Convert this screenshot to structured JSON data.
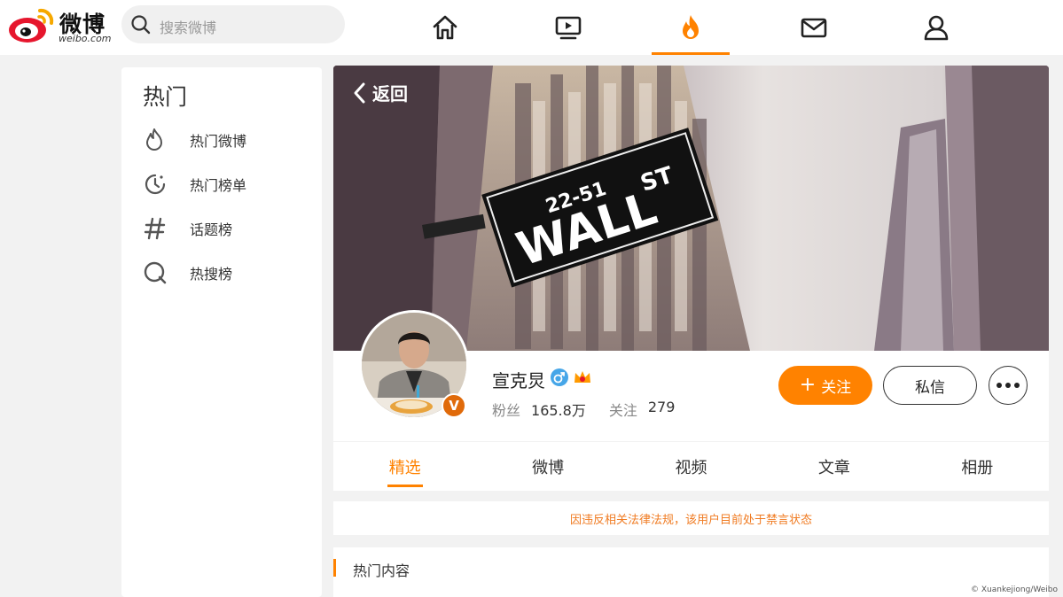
{
  "header": {
    "logo_text": "微博",
    "logo_sub": "weibo.com",
    "search_placeholder": "搜索微博",
    "nav": [
      {
        "name": "home-icon",
        "active": false
      },
      {
        "name": "video-icon",
        "active": false
      },
      {
        "name": "hot-fire-icon",
        "active": true
      },
      {
        "name": "mail-icon",
        "active": false
      },
      {
        "name": "profile-icon",
        "active": false
      }
    ]
  },
  "sidebar": {
    "title": "热门",
    "items": [
      {
        "label": "热门微博",
        "icon": "fire-outline-icon"
      },
      {
        "label": "热门榜单",
        "icon": "clock-icon"
      },
      {
        "label": "话题榜",
        "icon": "hashtag-icon"
      },
      {
        "label": "热搜榜",
        "icon": "search-ring-icon"
      }
    ]
  },
  "cover": {
    "back_label": "返回",
    "sign_number": "22-51",
    "sign_street": "WALL",
    "sign_suffix": "ST"
  },
  "profile": {
    "username": "宣克炅",
    "verified_badge": "V",
    "followers_label": "粉丝",
    "followers_value": "165.8万",
    "following_label": "关注",
    "following_value": "279",
    "follow_button": "关注",
    "message_button": "私信"
  },
  "tabs": [
    {
      "label": "精选",
      "active": true
    },
    {
      "label": "微博",
      "active": false
    },
    {
      "label": "视频",
      "active": false
    },
    {
      "label": "文章",
      "active": false
    },
    {
      "label": "相册",
      "active": false
    }
  ],
  "notice": "因违反相关法律法规，该用户目前处于禁言状态",
  "hot_section_title": "热门内容",
  "credit": "© Xuankejiong/Weibo",
  "colors": {
    "accent": "#ff8200",
    "notice": "#f07b22",
    "brand_red": "#e6162d"
  }
}
